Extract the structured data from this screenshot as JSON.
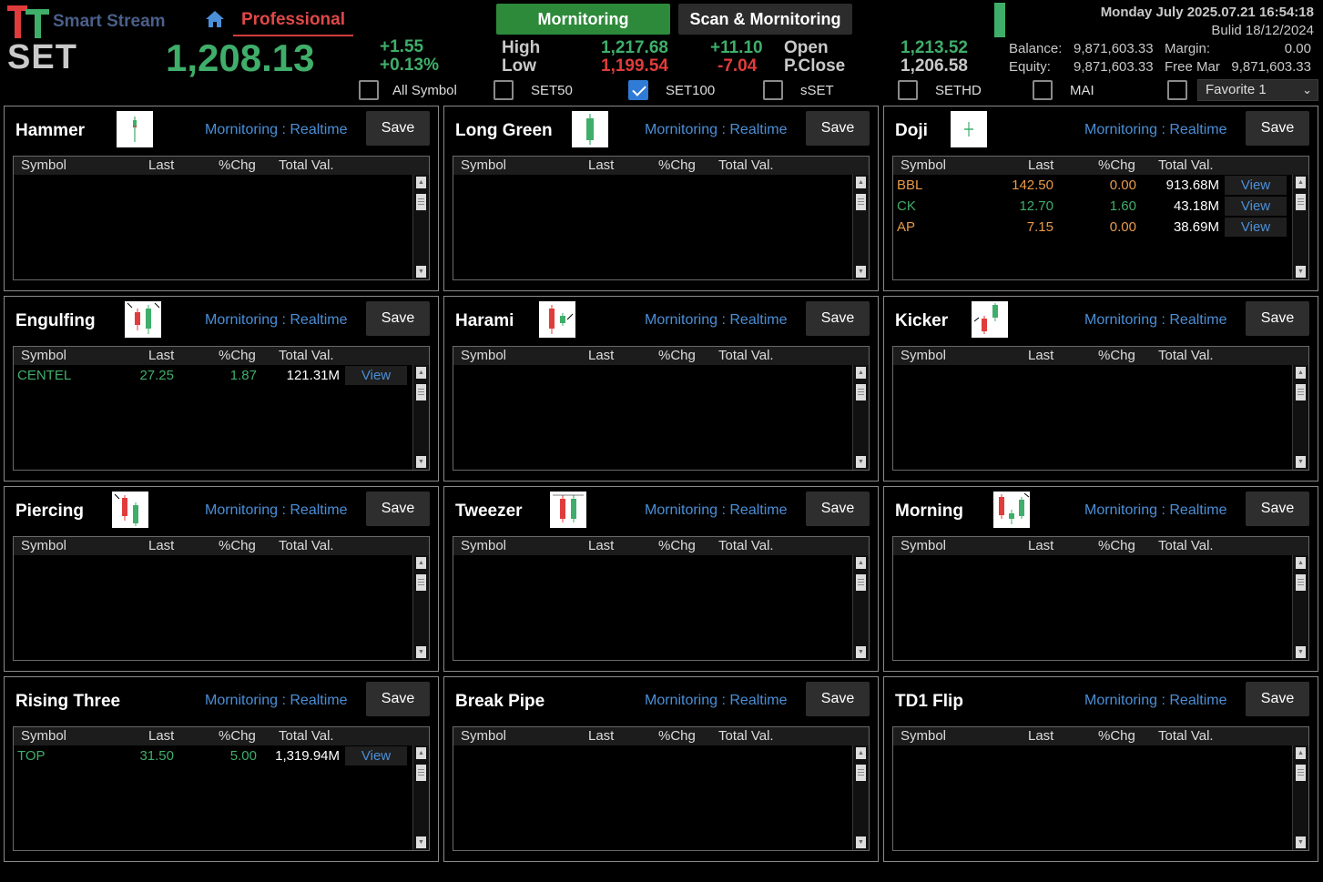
{
  "header": {
    "brand": "Smart Stream",
    "edition": "Professional",
    "index_name": "SET",
    "index_price": "1,208.13",
    "change": "+1.55",
    "change_pct": "+0.13%",
    "tabs": [
      "Mornitoring",
      "Scan & Mornitoring"
    ],
    "high_label": "High",
    "high_value": "1,217.68",
    "high_diff": "+11.10",
    "low_label": "Low",
    "low_value": "1,199.54",
    "low_diff": "-7.04",
    "open_label": "Open",
    "open_value": "1,213.52",
    "pclose_label": "P.Close",
    "pclose_value": "1,206.58",
    "datetime": "Monday July 2025.07.21 16:54:18",
    "build": "Bulid 18/12/2024",
    "balance_label": "Balance:",
    "balance": "9,871,603.33",
    "margin_label": "Margin:",
    "margin": "0.00",
    "equity_label": "Equity:",
    "equity": "9,871,603.33",
    "freemargin_label": "Free Mar",
    "freemargin": "9,871,603.33",
    "colors": {
      "up": "#3fae6a",
      "down": "#e03c3c",
      "accent": "#4a8fd8"
    }
  },
  "filters": [
    {
      "label": "All Symbol",
      "checked": false
    },
    {
      "label": "SET50",
      "checked": false
    },
    {
      "label": "SET100",
      "checked": true
    },
    {
      "label": "sSET",
      "checked": false
    },
    {
      "label": "SETHD",
      "checked": false
    },
    {
      "label": "MAI",
      "checked": false
    }
  ],
  "favorite": "Favorite 1",
  "columns": [
    "Symbol",
    "Last",
    "%Chg",
    "Total Val."
  ],
  "mode_label": "Mornitoring : Realtime",
  "save_label": "Save",
  "view_label": "View",
  "panels": [
    {
      "title": "Hammer",
      "icon": "hammer-candle-icon",
      "rows": []
    },
    {
      "title": "Long Green",
      "icon": "long-green-candle-icon",
      "rows": []
    },
    {
      "title": "Doji",
      "icon": "doji-candle-icon",
      "rows": [
        {
          "symbol": "BBL",
          "last": "142.50",
          "chg": "0.00",
          "val": "913.68M",
          "tone": "orange"
        },
        {
          "symbol": "CK",
          "last": "12.70",
          "chg": "1.60",
          "val": "43.18M",
          "tone": "green"
        },
        {
          "symbol": "AP",
          "last": "7.15",
          "chg": "0.00",
          "val": "38.69M",
          "tone": "orange"
        }
      ]
    },
    {
      "title": "Engulfing",
      "icon": "engulfing-candle-icon",
      "rows": [
        {
          "symbol": "CENTEL",
          "last": "27.25",
          "chg": "1.87",
          "val": "121.31M",
          "tone": "green"
        }
      ]
    },
    {
      "title": "Harami",
      "icon": "harami-candle-icon",
      "rows": []
    },
    {
      "title": "Kicker",
      "icon": "kicker-candle-icon",
      "rows": []
    },
    {
      "title": "Piercing",
      "icon": "piercing-candle-icon",
      "rows": []
    },
    {
      "title": "Tweezer",
      "icon": "tweezer-candle-icon",
      "rows": []
    },
    {
      "title": "Morning",
      "icon": "morning-star-candle-icon",
      "rows": []
    },
    {
      "title": "Rising Three",
      "icon": "",
      "rows": [
        {
          "symbol": "TOP",
          "last": "31.50",
          "chg": "5.00",
          "val": "1,319.94M",
          "tone": "green"
        }
      ]
    },
    {
      "title": "Break Pipe",
      "icon": "",
      "rows": []
    },
    {
      "title": "TD1 Flip",
      "icon": "",
      "rows": []
    }
  ]
}
